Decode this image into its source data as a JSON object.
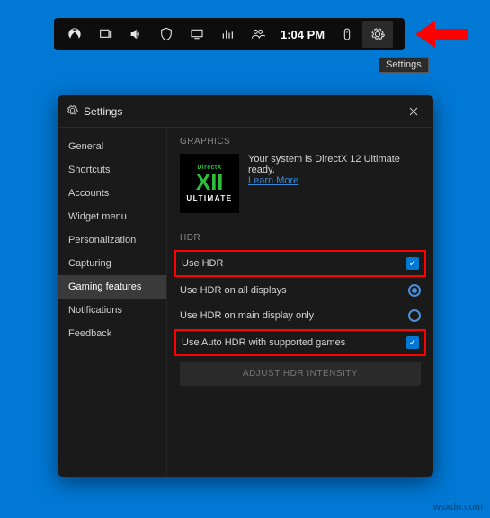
{
  "gamebar": {
    "time": "1:04 PM"
  },
  "tooltip": "Settings",
  "panel": {
    "title": "Settings"
  },
  "sidebar": {
    "items": [
      {
        "label": "General"
      },
      {
        "label": "Shortcuts"
      },
      {
        "label": "Accounts"
      },
      {
        "label": "Widget menu"
      },
      {
        "label": "Personalization"
      },
      {
        "label": "Capturing"
      },
      {
        "label": "Gaming features"
      },
      {
        "label": "Notifications"
      },
      {
        "label": "Feedback"
      }
    ],
    "active_index": 6
  },
  "content": {
    "graphics_label": "GRAPHICS",
    "dx_badge_top": "DirectX",
    "dx_badge_mid": "XII",
    "dx_badge_bot": "ULTIMATE",
    "dx_status": "Your system is DirectX 12 Ultimate ready.",
    "learn_more": "Learn More",
    "hdr_label": "HDR",
    "use_hdr": "Use HDR",
    "use_hdr_all": "Use HDR on all displays",
    "use_hdr_main": "Use HDR on main display only",
    "use_auto_hdr": "Use Auto HDR with supported games",
    "adjust_btn": "ADJUST HDR INTENSITY"
  },
  "watermark": "wsxdn.com"
}
